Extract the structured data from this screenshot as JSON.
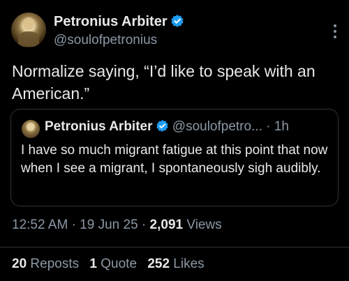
{
  "author": {
    "name": "Petronius Arbiter",
    "handle": "@soulofpetronius"
  },
  "tweet": {
    "text": "Normalize saying, “I’d like to speak with an American.”"
  },
  "quoted": {
    "name": "Petronius Arbiter",
    "handle": "@soulofpetro...",
    "separator": "·",
    "time": "1h",
    "text": "I have so much migrant fatigue at this point that now when I see a migrant, I spontaneously sigh audibly."
  },
  "meta": {
    "time": "12:52 AM",
    "date": "19 Jun 25",
    "views_count": "2,091",
    "views_label": "Views",
    "separator": "·"
  },
  "stats": {
    "reposts_count": "20",
    "reposts_label": "Reposts",
    "quotes_count": "1",
    "quotes_label": "Quote",
    "likes_count": "252",
    "likes_label": "Likes"
  },
  "colors": {
    "background": "#000000",
    "text": "#e7e9ea",
    "secondary": "#8b98a5",
    "verified": "#1d9bf0",
    "border": "#2f3336"
  },
  "icons": {
    "verified": "verified-badge-icon",
    "more": "more-vertical-icon"
  }
}
